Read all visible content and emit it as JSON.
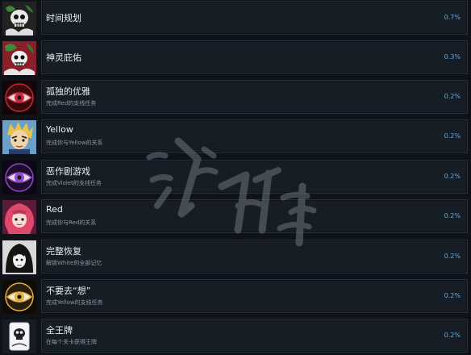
{
  "achievements": [
    {
      "title": "时间规划",
      "desc": "",
      "pct": "0.7%",
      "icon": "skull-flower-icon",
      "colors": {
        "bg": "#2b2b2b",
        "accent": "#3a8a3a"
      }
    },
    {
      "title": "神灵庇佑",
      "desc": "",
      "pct": "0.3%",
      "icon": "skull-flower-red-icon",
      "colors": {
        "bg": "#8a1f2a",
        "accent": "#3a8a3a"
      }
    },
    {
      "title": "孤独的优雅",
      "desc": "完成Red的支线任务",
      "pct": "0.2%",
      "icon": "red-eye-icon",
      "colors": {
        "bg": "#3a0a0a",
        "accent": "#c2283a"
      }
    },
    {
      "title": "Yellow",
      "desc": "完成你与Yellow的关系",
      "pct": "0.2%",
      "icon": "yellow-character-avatar-icon",
      "colors": {
        "bg": "#d9a43a",
        "accent": "#e8c24a"
      }
    },
    {
      "title": "恶作剧游戏",
      "desc": "完成Violet的支线任务",
      "pct": "0.2%",
      "icon": "violet-eye-icon",
      "colors": {
        "bg": "#1e0c2a",
        "accent": "#8a4ac2"
      }
    },
    {
      "title": "Red",
      "desc": "完成你与Red的关系",
      "pct": "0.2%",
      "icon": "red-character-avatar-icon",
      "colors": {
        "bg": "#5a1a3a",
        "accent": "#e04a6a"
      }
    },
    {
      "title": "完整恢复",
      "desc": "解锁White的全部记忆",
      "pct": "0.2%",
      "icon": "white-character-avatar-icon",
      "colors": {
        "bg": "#1a1a1a",
        "accent": "#e0e0e0"
      }
    },
    {
      "title": "不要去“想”",
      "desc": "完成Yellow的支线任务",
      "pct": "0.2%",
      "icon": "yellow-eye-icon",
      "colors": {
        "bg": "#2a1e08",
        "accent": "#e0b040"
      }
    },
    {
      "title": "全王牌",
      "desc": "在每个关卡获得王牌",
      "pct": "0.2%",
      "icon": "ace-card-icon",
      "colors": {
        "bg": "#1a1a22",
        "accent": "#cfd6e0"
      }
    }
  ]
}
